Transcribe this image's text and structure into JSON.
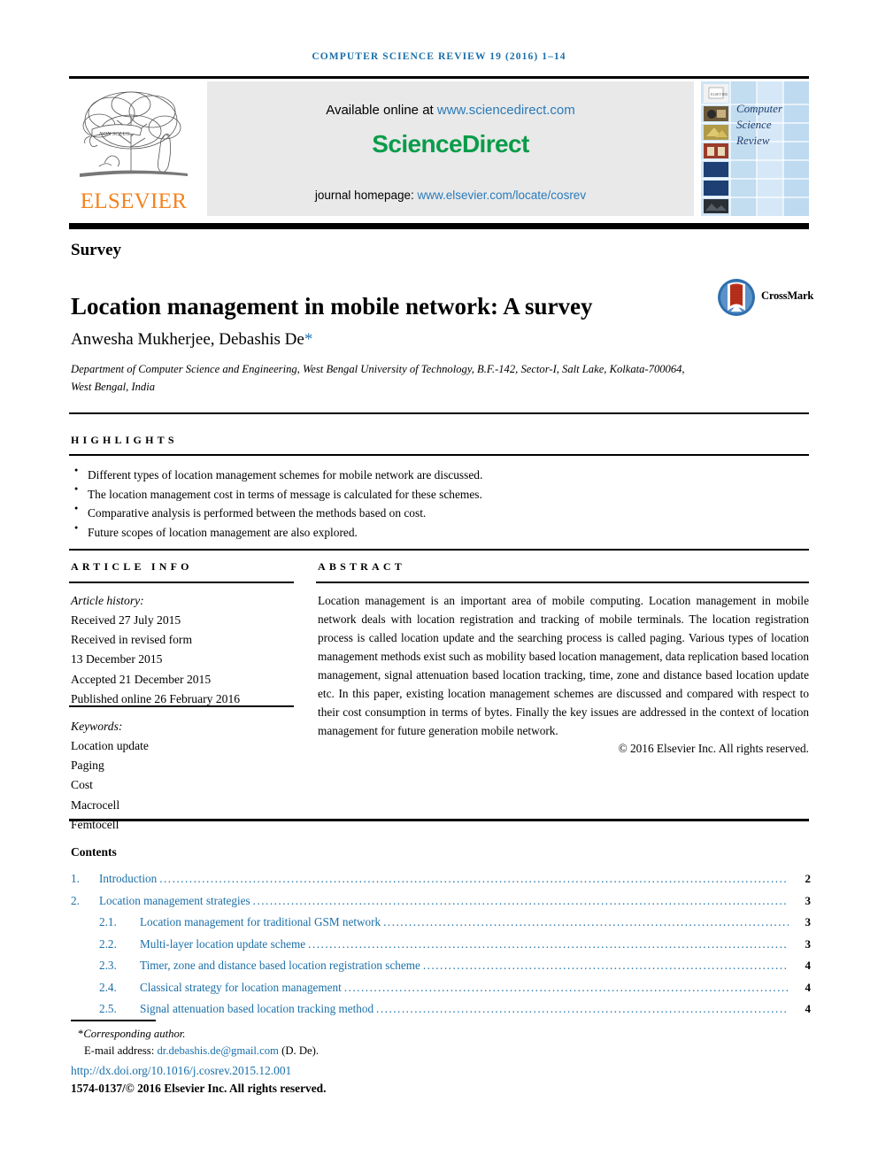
{
  "running_head": "COMPUTER SCIENCE REVIEW 19 (2016) 1–14",
  "header": {
    "publisher_name": "ELSEVIER",
    "available_prefix": "Available online at ",
    "available_link": "www.sciencedirect.com",
    "sciencedirect_logo_part1": "Science",
    "sciencedirect_logo_part2": "Direct",
    "homepage_prefix": "journal homepage: ",
    "homepage_link": "www.elsevier.com/locate/cosrev",
    "cover_line1": "Computer",
    "cover_line2": "Science",
    "cover_line3": "Review",
    "colors": {
      "elsevier_orange": "#F5821F",
      "sciencedirect_green": "#0a9c4a",
      "link_blue": "#2a7ab9",
      "band_gray": "#e9e9e9",
      "cover_blue": "#cfe4f4"
    }
  },
  "article": {
    "type": "Survey",
    "title": "Location management in mobile network: A survey",
    "crossmark_label": "CrossMark",
    "authors": "Anwesha Mukherjee, Debashis De",
    "author_star": "*",
    "affiliation": "Department of Computer Science and Engineering, West Bengal University of Technology, B.F.-142, Sector-I, Salt Lake, Kolkata-700064, West Bengal, India"
  },
  "highlights": {
    "heading": "HIGHLIGHTS",
    "items": [
      "Different types of location management schemes for mobile network are discussed.",
      "The location management cost in terms of message is calculated for these schemes.",
      "Comparative analysis is performed between the methods based on cost.",
      "Future scopes of location management are also explored."
    ]
  },
  "article_info": {
    "heading": "ARTICLE INFO",
    "history_label": "Article history:",
    "history_lines": [
      "Received 27 July 2015",
      "Received in revised form",
      "13 December 2015",
      "Accepted 21 December 2015",
      "Published online 26 February 2016"
    ],
    "keywords_label": "Keywords:",
    "keywords": [
      "Location update",
      "Paging",
      "Cost",
      "Macrocell",
      "Femtocell"
    ]
  },
  "abstract": {
    "heading": "ABSTRACT",
    "text": "Location management is an important area of mobile computing. Location management in mobile network deals with location registration and tracking of mobile terminals. The location registration process is called location update and the searching process is called paging. Various types of location management methods exist such as mobility based location management, data replication based location management, signal attenuation based location tracking, time, zone and distance based location update etc. In this paper, existing location management schemes are discussed and compared with respect to their cost consumption in terms of bytes. Finally the key issues are addressed in the context of location management for future generation mobile network.",
    "copyright": "© 2016 Elsevier Inc. All rights reserved."
  },
  "contents": {
    "heading": "Contents",
    "entries": [
      {
        "level": 1,
        "number": "1.",
        "label": "Introduction",
        "page": "2"
      },
      {
        "level": 1,
        "number": "2.",
        "label": "Location management strategies",
        "page": "3"
      },
      {
        "level": 2,
        "number": "2.1.",
        "label": "Location management for traditional GSM network",
        "page": "3"
      },
      {
        "level": 2,
        "number": "2.2.",
        "label": "Multi-layer location update scheme",
        "page": "3"
      },
      {
        "level": 2,
        "number": "2.3.",
        "label": "Timer, zone and distance based location registration scheme",
        "page": "4"
      },
      {
        "level": 2,
        "number": "2.4.",
        "label": "Classical strategy for location management",
        "page": "4"
      },
      {
        "level": 2,
        "number": "2.5.",
        "label": "Signal attenuation based location tracking method",
        "page": "4"
      }
    ]
  },
  "footer": {
    "corresponding_marker": "*",
    "corresponding_label": "Corresponding author.",
    "email_label": "E-mail address: ",
    "email": "dr.debashis.de@gmail.com",
    "email_suffix": " (D. De).",
    "doi": "http://dx.doi.org/10.1016/j.cosrev.2015.12.001",
    "issn_line": "1574-0137/© 2016 Elsevier Inc. All rights reserved."
  }
}
